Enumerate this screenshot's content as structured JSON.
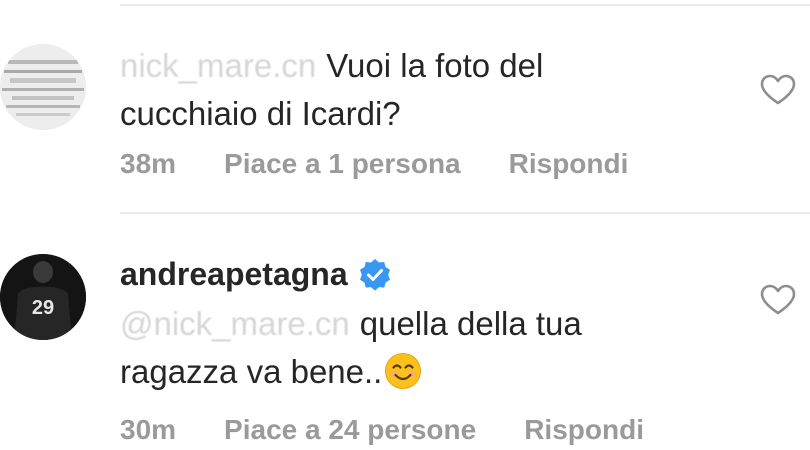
{
  "comments": [
    {
      "mention": "nick_mare.cn",
      "text_line1": "Vuoi la foto del",
      "text_line2": "cucchiaio di Icardi?",
      "time": "38m",
      "likes": "Piace a 1 persona",
      "reply": "Rispondi",
      "like_icon": "heart-outline-icon"
    },
    {
      "username": "andreapetagna",
      "verified_icon": "verified-badge-icon",
      "avatar_jersey_number": "29",
      "mention": "@nick_mare.cn",
      "text_line1": "quella della tua",
      "text_line2": "ragazza va bene..",
      "emoji": "smiling-face-emoji",
      "time": "30m",
      "likes": "Piace a 24 persone",
      "reply": "Rispondi",
      "like_icon": "heart-outline-icon"
    }
  ],
  "colors": {
    "text": "#262626",
    "meta": "#9a9a9a",
    "verified": "#3897f0",
    "divider": "#ececec"
  }
}
